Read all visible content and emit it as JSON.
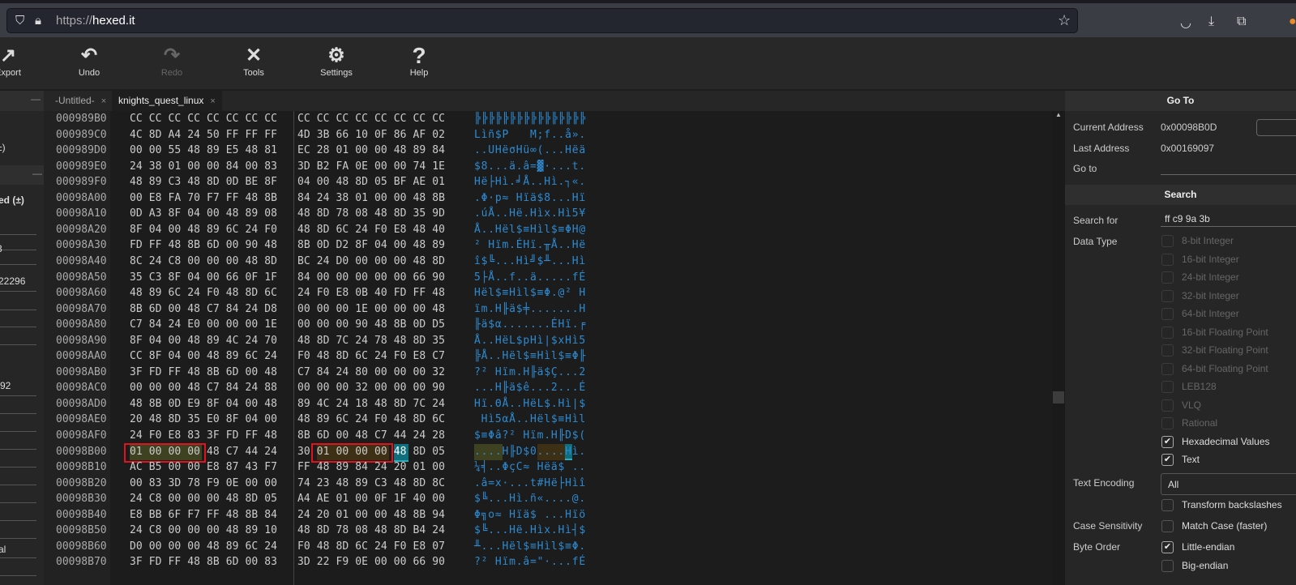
{
  "browser": {
    "url_scheme": "https://",
    "url_host": "hexed.it",
    "icons": [
      "shield-icon",
      "lock-icon",
      "star-icon",
      "pocket-icon",
      "download-icon",
      "extensions-icon",
      "profile-icon"
    ]
  },
  "toolbar": {
    "items": [
      {
        "label": "Export",
        "icon": "export-icon"
      },
      {
        "label": "Undo",
        "icon": "undo-icon"
      },
      {
        "label": "Redo",
        "icon": "redo-icon",
        "disabled": true
      },
      {
        "label": "Tools",
        "icon": "tools-icon"
      },
      {
        "label": "Settings",
        "icon": "gear-icon"
      },
      {
        "label": "Help",
        "icon": "help-icon"
      }
    ]
  },
  "tabs": [
    {
      "label": "-Untitled-",
      "close": "×"
    },
    {
      "label": "knights_quest_linux",
      "close": "×",
      "active": true
    }
  ],
  "left_panel": {
    "collapse": "—",
    "fragments": [
      "±)",
      "ed (±)",
      "3",
      "22296",
      "92",
      ":",
      "al",
      ":"
    ]
  },
  "hex": {
    "rows": [
      {
        "addr": "000989B0",
        "bytes": "CC CC CC CC CC CC CC CC CC CC CC CC CC CC CC CC",
        "ascii": "╠╠╠╠╠╠╠╠╠╠╠╠╠╠╠╠"
      },
      {
        "addr": "000989C0",
        "bytes": "4C 8D A4 24 50 FF FF FF 4D 3B 66 10 0F 86 AF 02",
        "ascii": "Lìñ$P   M;f..å»."
      },
      {
        "addr": "000989D0",
        "bytes": "00 00 55 48 89 E5 48 81 EC 28 01 00 00 48 89 84",
        "ascii": "..UHëσHü∞(...Hëä"
      },
      {
        "addr": "000989E0",
        "bytes": "24 38 01 00 00 84 00 83 3D B2 FA 0E 00 00 74 1E",
        "ascii": "$8...ä.â=▓·...t."
      },
      {
        "addr": "000989F0",
        "bytes": "48 89 C3 48 8D 0D BE 8F 04 00 48 8D 05 BF AE 01",
        "ascii": "Hë├Hì.╛Å..Hì.┐«."
      },
      {
        "addr": "00098A00",
        "bytes": "00 E8 FA 70 F7 FF 48 8B 84 24 38 01 00 00 48 8B",
        "ascii": ".Φ·p≈ Hïä$8...Hï"
      },
      {
        "addr": "00098A10",
        "bytes": "0D A3 8F 04 00 48 89 08 48 8D 78 08 48 8D 35 9D",
        "ascii": ".úÅ..Hë.Hìx.Hì5¥"
      },
      {
        "addr": "00098A20",
        "bytes": "8F 04 00 48 89 6C 24 F0 48 8D 6C 24 F0 E8 48 40",
        "ascii": "Å..Hël$≡Hìl$≡ΦH@"
      },
      {
        "addr": "00098A30",
        "bytes": "FD FF 48 8B 6D 00 90 48 8B 0D D2 8F 04 00 48 89",
        "ascii": "² Hïm.ÉHï.╥Å..Hë"
      },
      {
        "addr": "00098A40",
        "bytes": "8C 24 C8 00 00 00 48 8D BC 24 D0 00 00 00 48 8D",
        "ascii": "î$╚...Hì╝$╨...Hì"
      },
      {
        "addr": "00098A50",
        "bytes": "35 C3 8F 04 00 66 0F 1F 84 00 00 00 00 00 66 90",
        "ascii": "5├Å..f..ä.....fÉ"
      },
      {
        "addr": "00098A60",
        "bytes": "48 89 6C 24 F0 48 8D 6C 24 F0 E8 0B 40 FD FF 48",
        "ascii": "Hël$≡Hìl$≡Φ.@² H"
      },
      {
        "addr": "00098A70",
        "bytes": "8B 6D 00 48 C7 84 24 D8 00 00 00 1E 00 00 00 48",
        "ascii": "ïm.H╟ä$╪.......H"
      },
      {
        "addr": "00098A80",
        "bytes": "C7 84 24 E0 00 00 00 1E 00 00 00 90 48 8B 0D D5",
        "ascii": "╟ä$α.......ÉHï.╒"
      },
      {
        "addr": "00098A90",
        "bytes": "8F 04 00 48 89 4C 24 70 48 8D 7C 24 78 48 8D 35",
        "ascii": "Å..HëL$pHì|$xHì5"
      },
      {
        "addr": "00098AA0",
        "bytes": "CC 8F 04 00 48 89 6C 24 F0 48 8D 6C 24 F0 E8 C7",
        "ascii": "╠Å..Hël$≡Hìl$≡Φ╟"
      },
      {
        "addr": "00098AB0",
        "bytes": "3F FD FF 48 8B 6D 00 48 C7 84 24 80 00 00 00 32",
        "ascii": "?² Hïm.H╟ä$Ç...2"
      },
      {
        "addr": "00098AC0",
        "bytes": "00 00 00 48 C7 84 24 88 00 00 00 32 00 00 00 90",
        "ascii": "...H╟ä$ê...2...É"
      },
      {
        "addr": "00098AD0",
        "bytes": "48 8B 0D E9 8F 04 00 48 89 4C 24 18 48 8D 7C 24",
        "ascii": "Hï.ΘÅ..HëL$.Hì|$"
      },
      {
        "addr": "00098AE0",
        "bytes": "20 48 8D 35 E0 8F 04 00 48 89 6C 24 F0 48 8D 6C",
        "ascii": " Hì5αÅ..Hël$≡Hìl"
      },
      {
        "addr": "00098AF0",
        "bytes": "24 F0 E8 83 3F FD FF 48 8B 6D 00 48 C7 44 24 28",
        "ascii": "$≡Φâ?² Hïm.H╟D$("
      },
      {
        "addr": "00098B00",
        "bytes": "01 00 00 00 48 C7 44 24 30 01 00 00 00 48 8D 05",
        "ascii": "....H╟D$0....Hì."
      },
      {
        "addr": "00098B10",
        "bytes": "AC B5 00 00 E8 87 43 F7 FF 48 89 84 24 20 01 00",
        "ascii": "¼╡..ΦçC≈ Hëä$ .."
      },
      {
        "addr": "00098B20",
        "bytes": "00 83 3D 78 F9 0E 00 00 74 23 48 89 C3 48 8D 8C",
        "ascii": ".â=x·...t#Hë├Hìî"
      },
      {
        "addr": "00098B30",
        "bytes": "24 C8 00 00 00 48 8D 05 A4 AE 01 00 0F 1F 40 00",
        "ascii": "$╚...Hì.ñ«....@."
      },
      {
        "addr": "00098B40",
        "bytes": "E8 BB 6F F7 FF 48 8B 84 24 20 01 00 00 48 8B 94",
        "ascii": "Φ╗o≈ Hïä$ ...Hïö"
      },
      {
        "addr": "00098B50",
        "bytes": "24 C8 00 00 00 48 89 10 48 8D 78 08 48 8D B4 24",
        "ascii": "$╚...Hë.Hìx.Hì┤$"
      },
      {
        "addr": "00098B60",
        "bytes": "D0 00 00 00 48 89 6C 24 F0 48 8D 6C 24 F0 E8 07",
        "ascii": "╨...Hël$≡Hìl$≡Φ."
      },
      {
        "addr": "00098B70",
        "bytes": "3F FD FF 48 8B 6D 00 83 3D 22 F9 0E 00 00 66 90",
        "ascii": "?² Hïm.â=\"·...fÉ"
      }
    ],
    "highlight": {
      "row": "00098B00",
      "match1": [
        0,
        3
      ],
      "match2": [
        9,
        12
      ],
      "cursor": 13
    },
    "colors": {
      "match1": "#3e4220",
      "match2": "#3e3014",
      "cursor": "#0f6f7d",
      "box": "#e0141e",
      "ascii": "#2e8ad0"
    }
  },
  "goto": {
    "title": "Go To",
    "current_label": "Current Address",
    "current_value": "0x00098B0D",
    "last_label": "Last Address",
    "last_value": "0x00169097",
    "goto_label": "Go to",
    "goto_value": ""
  },
  "search": {
    "title": "Search",
    "search_for_label": "Search for",
    "search_for_value": "ff c9 9a 3b",
    "data_type_label": "Data Type",
    "data_types": [
      {
        "label": "8-bit Integer",
        "checked": false,
        "disabled": true
      },
      {
        "label": "16-bit Integer",
        "checked": false,
        "disabled": true
      },
      {
        "label": "24-bit Integer",
        "checked": false,
        "disabled": true
      },
      {
        "label": "32-bit Integer",
        "checked": false,
        "disabled": true
      },
      {
        "label": "64-bit Integer",
        "checked": false,
        "disabled": true
      },
      {
        "label": "16-bit Floating Point",
        "checked": false,
        "disabled": true
      },
      {
        "label": "32-bit Floating Point",
        "checked": false,
        "disabled": true
      },
      {
        "label": "64-bit Floating Point",
        "checked": false,
        "disabled": true
      },
      {
        "label": "LEB128",
        "checked": false,
        "disabled": true
      },
      {
        "label": "VLQ",
        "checked": false,
        "disabled": true
      },
      {
        "label": "Rational",
        "checked": false,
        "disabled": true
      },
      {
        "label": "Hexadecimal Values",
        "checked": true
      },
      {
        "label": "Text",
        "checked": true
      }
    ],
    "text_encoding_label": "Text Encoding",
    "text_encoding_value": "All",
    "transform_label": "Transform backslashes",
    "transform_checked": false,
    "case_label": "Case Sensitivity",
    "match_case_label": "Match Case (faster)",
    "match_case_checked": false,
    "byte_order_label": "Byte Order",
    "little_label": "Little-endian",
    "little_checked": true,
    "big_label": "Big-endian",
    "big_checked": false
  }
}
